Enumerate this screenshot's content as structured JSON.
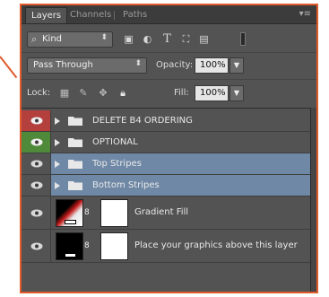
{
  "tabs": [
    {
      "label": "Layers",
      "active": true
    },
    {
      "label": "Channels",
      "active": false
    },
    {
      "label": "Paths",
      "active": false
    }
  ],
  "panel_menu_icon": "panel-menu-icon",
  "filter": {
    "kind_label": "Kind",
    "icons": [
      "image-filter-icon",
      "adjustment-filter-icon",
      "type-filter-icon",
      "shape-filter-icon",
      "smart-object-filter-icon"
    ],
    "type_glyph": "T"
  },
  "blend": {
    "mode": "Pass Through",
    "opacity_label": "Opacity:",
    "opacity_value": "100%",
    "lock_label": "Lock:",
    "fill_label": "Fill:",
    "fill_value": "100%"
  },
  "colors": {
    "accent_border": "#e05a2b",
    "red_label": "#b3403d",
    "green_label": "#4f8a3a",
    "selected": "#6f88a6",
    "panel_bg": "#535353"
  },
  "layers": [
    {
      "name": "DELETE B4 ORDERING",
      "type": "group",
      "label_color": "red",
      "selected": false
    },
    {
      "name": "OPTIONAL",
      "type": "group",
      "label_color": "green",
      "selected": false
    },
    {
      "name": "Top Stripes",
      "type": "group",
      "label_color": "none",
      "selected": true
    },
    {
      "name": "Bottom Stripes",
      "type": "group",
      "label_color": "none",
      "selected": true
    },
    {
      "name": "Gradient Fill",
      "type": "adjustment",
      "label_color": "none",
      "selected": false
    },
    {
      "name": "Place your graphics above this layer",
      "type": "adjustment",
      "label_color": "none",
      "selected": false
    }
  ]
}
